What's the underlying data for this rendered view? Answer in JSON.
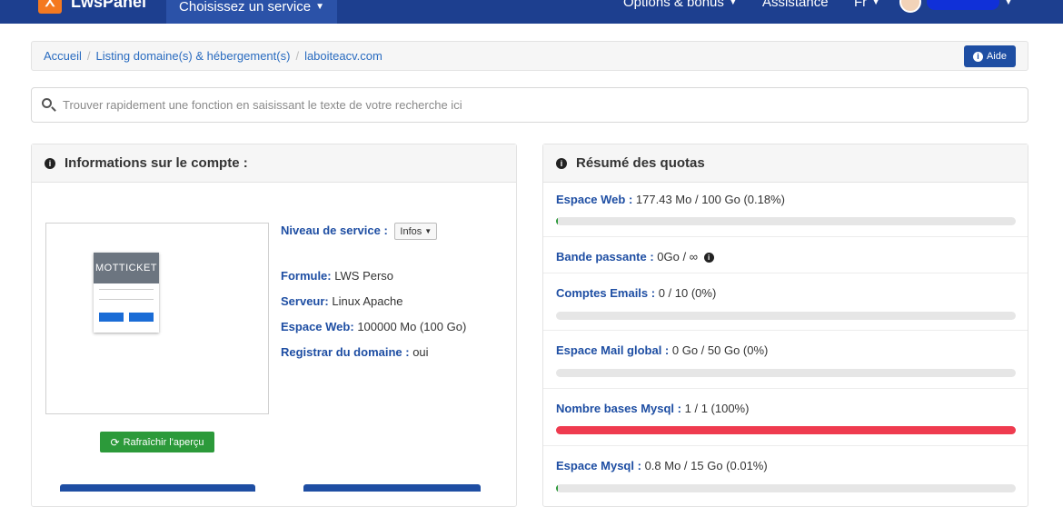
{
  "navbar": {
    "brand_name": "LwsPanel",
    "service_menu": "Choisissez un service",
    "options": "Options & bonus",
    "assistance": "Assistance",
    "lang": "Fr"
  },
  "breadcrumb": {
    "items": [
      "Accueil",
      "Listing domaine(s) & hébergement(s)",
      "laboiteacv.com"
    ],
    "help_label": "Aide"
  },
  "search": {
    "placeholder": "Trouver rapidement une fonction en saisissant le texte de votre recherche ici"
  },
  "account": {
    "title": "Informations sur le compte :",
    "thumb_text": "MOTTICKET",
    "refresh_label": "Rafraîchir l'aperçu",
    "service_level_label": "Niveau de service :",
    "service_level_dropdown": "Infos",
    "formule_label": "Formule:",
    "formule_value": "LWS Perso",
    "serveur_label": "Serveur:",
    "serveur_value": "Linux Apache",
    "espace_web_label": "Espace Web:",
    "espace_web_value": "100000 Mo (100 Go)",
    "registrar_label": "Registrar du domaine :",
    "registrar_value": "oui"
  },
  "quotas": {
    "title": "Résumé des quotas",
    "items": [
      {
        "label": "Espace Web :",
        "value": "177.43 Mo / 100 Go (0.18%)",
        "percent": 0.18,
        "bar": true,
        "color": "#2c9a3a"
      },
      {
        "label": "Bande passante :",
        "value": "0Go / ∞",
        "bar": false
      },
      {
        "label": "Comptes Emails :",
        "value": "0 / 10 (0%)",
        "percent": 0,
        "bar": true,
        "color": "#2c9a3a"
      },
      {
        "label": "Espace Mail global :",
        "value": "0 Go / 50 Go (0%)",
        "percent": 0,
        "bar": true,
        "color": "#2c9a3a"
      },
      {
        "label": "Nombre bases Mysql :",
        "value": "1 / 1 (100%)",
        "percent": 100,
        "bar": true,
        "color": "#ef3b4f"
      },
      {
        "label": "Espace Mysql :",
        "value": "0.8 Mo / 15 Go (0.01%)",
        "percent": 0.01,
        "bar": true,
        "color": "#2c9a3a"
      }
    ]
  }
}
